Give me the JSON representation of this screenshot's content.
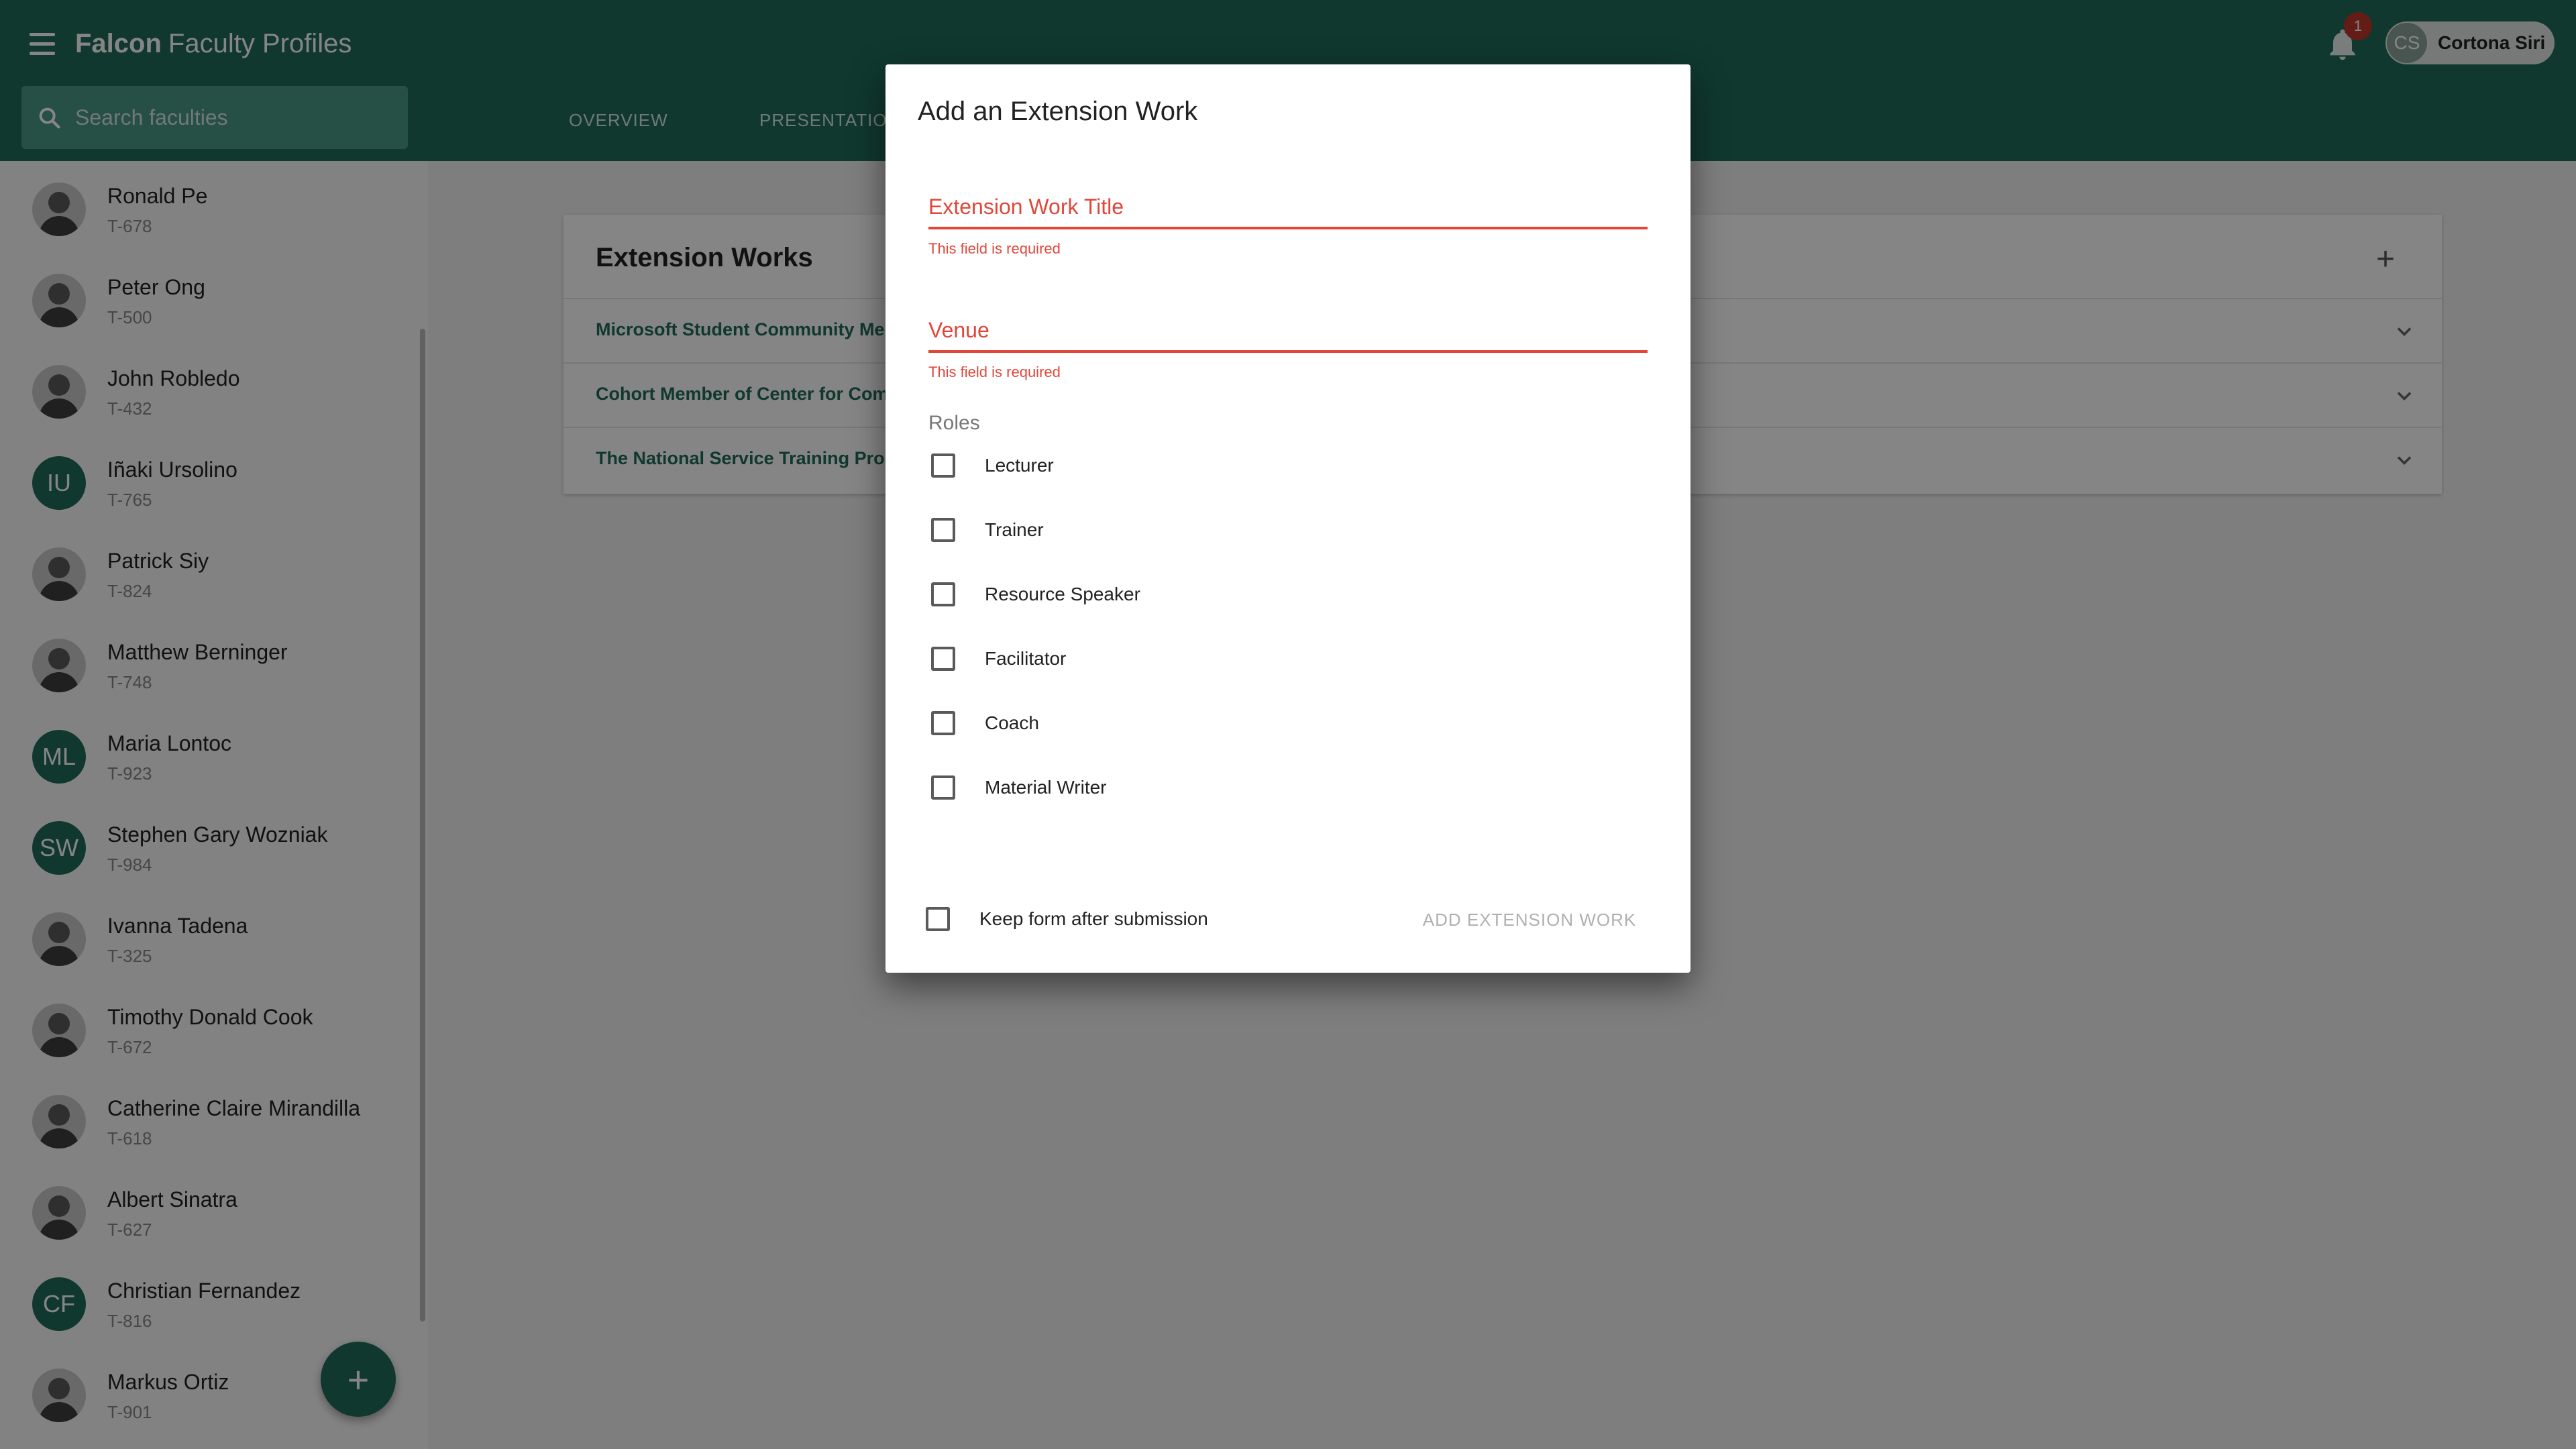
{
  "app": {
    "title_bold": "Falcon",
    "title_light": "Faculty Profiles"
  },
  "search": {
    "placeholder": "Search faculties",
    "value": ""
  },
  "tabs": [
    {
      "label": "OVERVIEW"
    },
    {
      "label": "PRESENTATIONS"
    }
  ],
  "notifications": {
    "count": "1"
  },
  "user": {
    "initials": "CS",
    "name": "Cortona Siri"
  },
  "faculties": [
    {
      "name": "Ronald Pe",
      "id": "T-678",
      "avatar": "photo"
    },
    {
      "name": "Peter Ong",
      "id": "T-500",
      "avatar": "photo"
    },
    {
      "name": "John Robledo",
      "id": "T-432",
      "avatar": "photo"
    },
    {
      "name": "Iñaki Ursolino",
      "id": "T-765",
      "avatar": "IU"
    },
    {
      "name": "Patrick Siy",
      "id": "T-824",
      "avatar": "photo"
    },
    {
      "name": "Matthew Berninger",
      "id": "T-748",
      "avatar": "photo"
    },
    {
      "name": "Maria Lontoc",
      "id": "T-923",
      "avatar": "ML"
    },
    {
      "name": "Stephen Gary Wozniak",
      "id": "T-984",
      "avatar": "SW"
    },
    {
      "name": "Ivanna Tadena",
      "id": "T-325",
      "avatar": "photo"
    },
    {
      "name": "Timothy Donald Cook",
      "id": "T-672",
      "avatar": "photo"
    },
    {
      "name": "Catherine Claire Mirandilla",
      "id": "T-618",
      "avatar": "photo"
    },
    {
      "name": "Albert Sinatra",
      "id": "T-627",
      "avatar": "photo"
    },
    {
      "name": "Christian Fernandez",
      "id": "T-816",
      "avatar": "CF"
    },
    {
      "name": "Markus Ortiz",
      "id": "T-901",
      "avatar": "photo"
    }
  ],
  "extension_works": {
    "title": "Extension Works",
    "items": [
      {
        "label": "Microsoft Student Community Mer"
      },
      {
        "label": "Cohort Member of Center for Comp"
      },
      {
        "label": "The National Service Training Prog"
      }
    ]
  },
  "dialog": {
    "title": "Add an Extension Work",
    "title_field": {
      "label": "Extension Work Title",
      "value": "",
      "error": "This field is required"
    },
    "venue_field": {
      "label": "Venue",
      "value": "",
      "error": "This field is required"
    },
    "roles_label": "Roles",
    "roles": [
      {
        "label": "Lecturer",
        "checked": false
      },
      {
        "label": "Trainer",
        "checked": false
      },
      {
        "label": "Resource Speaker",
        "checked": false
      },
      {
        "label": "Facilitator",
        "checked": false
      },
      {
        "label": "Coach",
        "checked": false
      },
      {
        "label": "Material Writer",
        "checked": false
      }
    ],
    "keep_form_label": "Keep form after submission",
    "keep_form_checked": false,
    "submit_label": "ADD EXTENSION WORK"
  },
  "colors": {
    "primary": "#1f6b58",
    "error": "#e0473a",
    "badge": "#c0392b"
  }
}
